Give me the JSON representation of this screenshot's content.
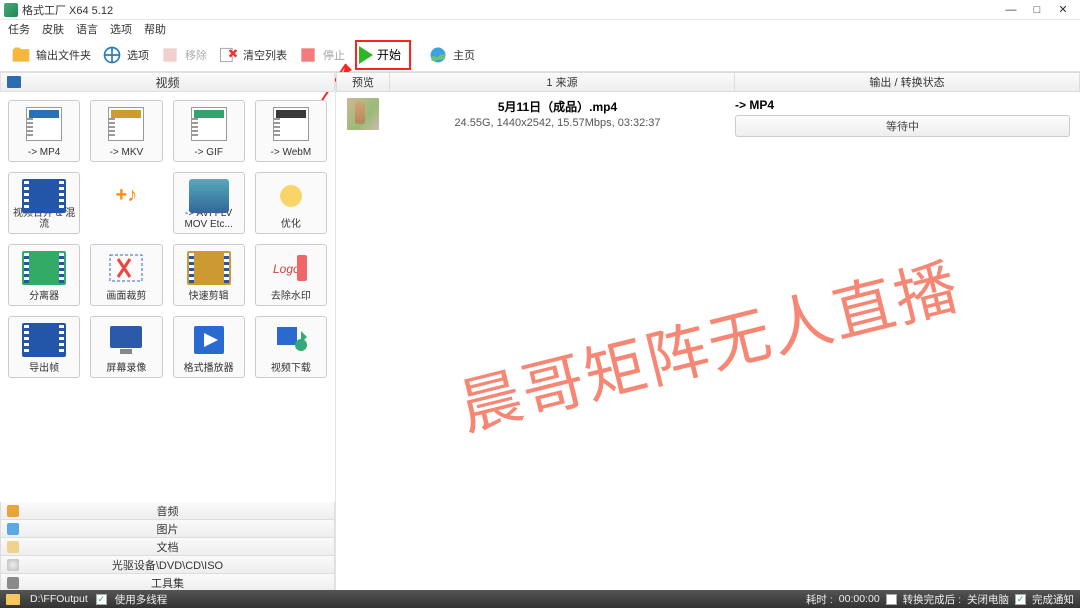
{
  "window": {
    "title": "格式工厂 X64 5.12"
  },
  "menu": {
    "task": "任务",
    "skin": "皮肤",
    "lang": "语言",
    "opts": "选项",
    "help": "帮助"
  },
  "toolbar": {
    "output_folder": "输出文件夹",
    "options": "选项",
    "remove": "移除",
    "clear_list": "清空列表",
    "stop": "停止",
    "start": "开始",
    "home": "主页"
  },
  "left": {
    "header": "视频",
    "formats": [
      {
        "label": "-> MP4",
        "tag": "MP4",
        "tagColor": "#2b6fb5"
      },
      {
        "label": "-> MKV",
        "tag": "MKV",
        "tagColor": "#cf9b2e"
      },
      {
        "label": "-> GIF",
        "tag": "GIF",
        "tagColor": "#37a06c"
      },
      {
        "label": "-> WebM",
        "tag": "WebM",
        "tagColor": "#3a3a3a"
      },
      {
        "label": "视频合并 & 混流"
      },
      {
        "label": ""
      },
      {
        "label": "-> AVI FLV MOV Etc..."
      },
      {
        "label": "优化"
      },
      {
        "label": "分离器"
      },
      {
        "label": "画面裁剪"
      },
      {
        "label": "快速剪辑"
      },
      {
        "label": "去除水印"
      },
      {
        "label": "导出帧"
      },
      {
        "label": "屏幕录像"
      },
      {
        "label": "格式播放器"
      },
      {
        "label": "视频下载"
      }
    ],
    "cats": {
      "audio": "音频",
      "image": "图片",
      "doc": "文档",
      "disc": "光驱设备\\DVD\\CD\\ISO",
      "tools": "工具集"
    }
  },
  "right": {
    "cols": {
      "preview": "预览",
      "source": "1 来源",
      "output": "输出 / 转换状态"
    },
    "task": {
      "name": "5月11日（成品）.mp4",
      "meta": "24.55G, 1440x2542, 15.57Mbps, 03:32:37",
      "out_format": "-> MP4",
      "status": "等待中"
    }
  },
  "statusbar": {
    "path": "D:\\FFOutput",
    "multithread": "使用多线程",
    "elapsed_label": "耗时 :",
    "elapsed": "00:00:00",
    "after_label": "转换完成后 :",
    "shutdown": "关闭电脑",
    "notify": "完成通知"
  },
  "watermark": "晨哥矩阵无人直播"
}
